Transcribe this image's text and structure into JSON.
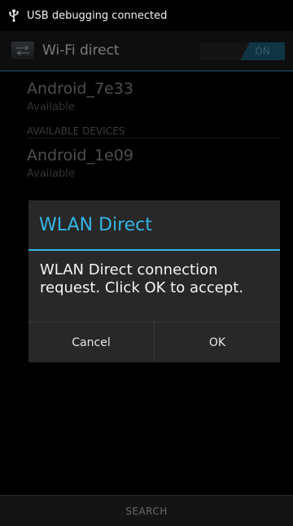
{
  "status_bar": {
    "usb_icon": "usb-icon",
    "text": "USB debugging connected"
  },
  "action_bar": {
    "app_icon": "wifi-direct-icon",
    "title": "Wi-Fi direct",
    "toggle_label": "ON",
    "toggle_state": "on"
  },
  "list": {
    "connected_device": {
      "name": "Android_7e33",
      "status": "Available"
    },
    "section_header": "AVAILABLE DEVICES",
    "available_devices": [
      {
        "name": "Android_1e09",
        "status": "Available"
      }
    ]
  },
  "dialog": {
    "title": "WLAN Direct",
    "message": "WLAN Direct connection request. Click OK to accept.",
    "cancel_label": "Cancel",
    "ok_label": "OK"
  },
  "bottom_bar": {
    "search_label": "SEARCH"
  },
  "colors": {
    "accent": "#33b5e5",
    "toggle_on": "#1d5f7b"
  }
}
